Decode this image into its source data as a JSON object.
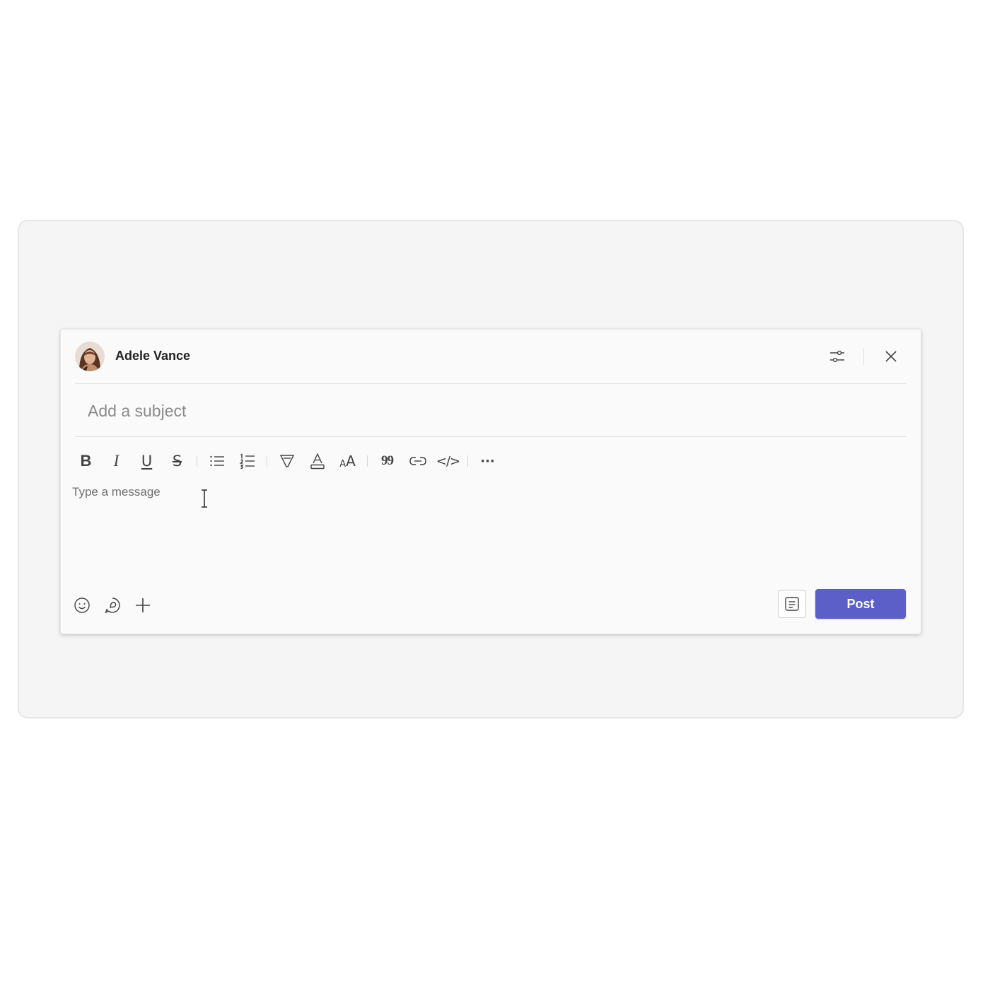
{
  "compose": {
    "author_name": "Adele Vance",
    "subject_placeholder": "Add a subject",
    "message_placeholder": "Type a message",
    "post_label": "Post"
  },
  "toolbar": {
    "items": [
      {
        "name": "bold",
        "glyph": "B"
      },
      {
        "name": "italic",
        "glyph": "I"
      },
      {
        "name": "underline",
        "glyph": "U"
      },
      {
        "name": "strikethrough",
        "glyph": "S"
      },
      {
        "name": "bulleted-list",
        "glyph": "list-bullets"
      },
      {
        "name": "numbered-list",
        "glyph": "list-numbers"
      },
      {
        "name": "highlight",
        "glyph": "highlighter"
      },
      {
        "name": "font-color",
        "glyph": "font-color"
      },
      {
        "name": "font-size",
        "glyph": "AA"
      },
      {
        "name": "quote",
        "glyph": "99"
      },
      {
        "name": "link",
        "glyph": "link"
      },
      {
        "name": "code",
        "glyph": "</>"
      },
      {
        "name": "more-options",
        "glyph": "…"
      }
    ],
    "quote_glyph": "99",
    "bold_glyph": "B",
    "italic_glyph": "I",
    "underline_glyph": "U",
    "strike_glyph": "S",
    "size_glyph_small": "A",
    "size_glyph_large": "A",
    "code_glyph": "</>",
    "more_glyph": "···"
  },
  "colors": {
    "accent": "#5b5fc7",
    "icon": "#424242",
    "card_background": "#fafafa",
    "stage_background": "#f5f5f5"
  },
  "icons": [
    "settings-sliders-icon",
    "close-icon",
    "emoji-icon",
    "sticker-icon",
    "add-icon",
    "format-icon",
    "text-cursor-icon"
  ]
}
